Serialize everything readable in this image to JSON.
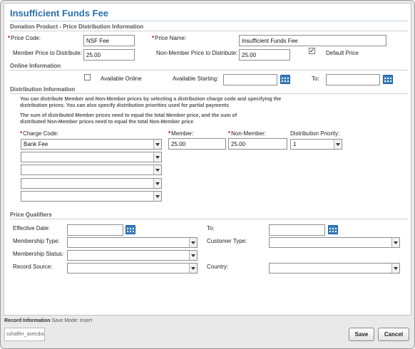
{
  "title": "Insufficient Funds Fee",
  "sections": {
    "price_distribution": "Donation Product - Price Distribution Information",
    "online": "Online Information",
    "distribution": "Distribution Information",
    "qualifiers": "Price Qualifiers"
  },
  "price": {
    "code_label": "Price Code:",
    "code_value": "NSF Fee",
    "name_label": "Price Name:",
    "name_value": "Insufficient Funds Fee",
    "member_label": "Member Price to Distribute:",
    "member_value": "25.00",
    "nonmember_label": "Non-Member Price to Distribute:",
    "nonmember_value": "25.00",
    "default_label": "Default Price",
    "default_checked": "✓"
  },
  "online": {
    "available_label": "Available Online",
    "starting_label": "Available Starting:",
    "to_label": "To:"
  },
  "distribution": {
    "note1": "You can distribute Member and Non-Member prices by selecting a distribution charge code and specifying the distribution prices. You can also specify distribution priorities used for partial payments",
    "note2": "The sum of distributed Member prices need to equal the total Member price, and the sum of distributed Non-Member prices need to equal the total Non-Member price",
    "charge_code_label": "Charge Code:",
    "member_label": "Member:",
    "nonmember_label": "Non-Member:",
    "priority_label": "Distribution Priority:",
    "rows": [
      {
        "charge_code": "Bank Fee",
        "member": "25.00",
        "nonmember": "25.00",
        "priority": "1"
      },
      {
        "charge_code": ""
      },
      {
        "charge_code": ""
      },
      {
        "charge_code": ""
      },
      {
        "charge_code": ""
      }
    ]
  },
  "qualifiers": {
    "effective_label": "Effective Date:",
    "to_label": "To:",
    "membership_type_label": "Membership Type:",
    "customer_type_label": "Customer Type:",
    "membership_status_label": "Membership Status:",
    "record_source_label": "Record Source:",
    "country_label": "Country:"
  },
  "footer": {
    "record_info": "Record Information",
    "save_mode": "Save Mode: Insert",
    "user": "sshaffer_avecdoo",
    "save_label": "Save",
    "cancel_label": "Cancel"
  },
  "colors": {
    "title": "#2a6fb1",
    "required": "#d00000",
    "calendar": "#3a7fc0"
  }
}
